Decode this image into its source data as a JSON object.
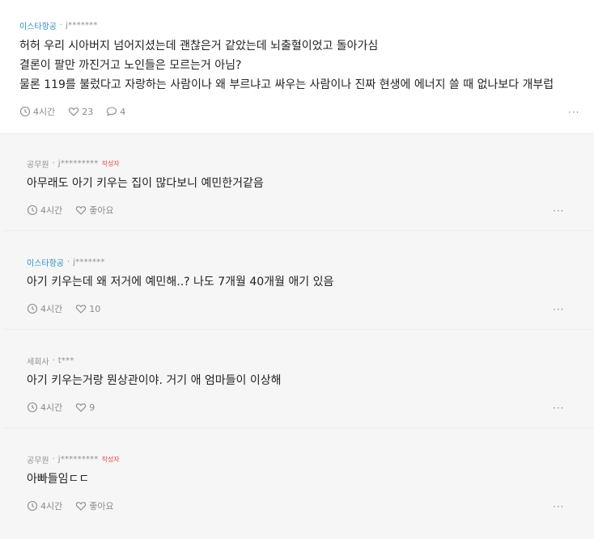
{
  "post": {
    "company": "이스타항공",
    "user": "j*******",
    "lines": [
      "허허 우리 시아버지 넘어지셨는데 괜찮은거 같았는데 뇌출혈이었고 돌아가심",
      "결론이 팔만 까진거고 노인들은 모르는거 아님?",
      "물론 119를 불렀다고 자랑하는 사람이나 왜 부르냐고 싸우는 사람이나 진짜 현생에 에너지 쓸 때 없나보다 개부럽"
    ],
    "time": "4시간",
    "likes": "23",
    "comments": "4",
    "more": "···"
  },
  "replies": [
    {
      "company": "공무원",
      "user": "j*********",
      "badge": "작성자",
      "text": "아무래도 아기 키우는 집이 많다보니 예민한거같음",
      "time": "4시간",
      "likes": "좋아요",
      "more": "···"
    },
    {
      "company": "이스타항공",
      "user": "j*******",
      "badge": "",
      "text": "아기 키우는데 왜 저거에 예민해..? 나도 7개월 40개월 애기 있음",
      "time": "4시간",
      "likes": "10",
      "more": "···"
    },
    {
      "company": "세회사",
      "user": "t***",
      "badge": "",
      "text": "아기 키우는거랑 뭔상관이야. 거기 애 엄마들이 이상해",
      "time": "4시간",
      "likes": "9",
      "more": "···"
    },
    {
      "company": "공무원",
      "user": "j*********",
      "badge": "작성자",
      "text": "아빠들임ㄷㄷ",
      "time": "4시간",
      "likes": "좋아요",
      "more": "···"
    }
  ],
  "sep": "·",
  "icons": {
    "time": "clock-icon",
    "like": "heart-icon",
    "comment": "speech-bubble-icon",
    "more": "more-icon"
  },
  "colors": {
    "company": "#2f8fbf",
    "badge": "#e14a4a",
    "reply_bg": "#f6f6f7"
  }
}
